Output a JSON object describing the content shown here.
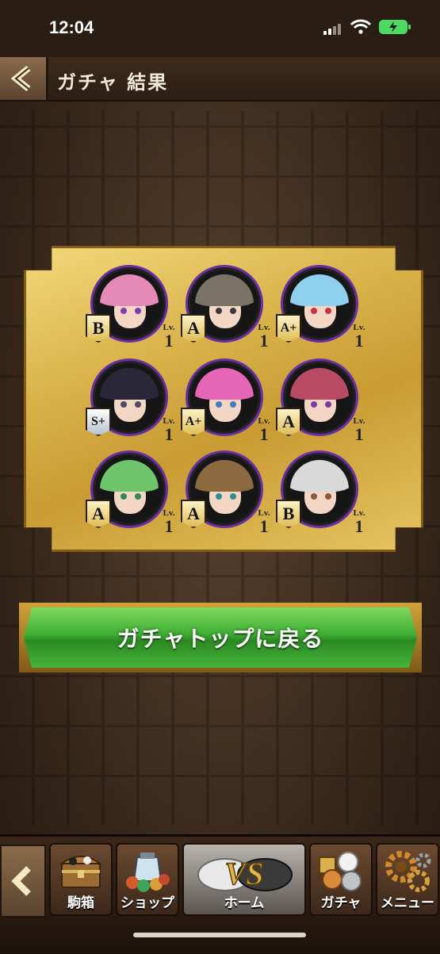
{
  "status_bar": {
    "time": "12:04"
  },
  "header": {
    "title": "ガチャ 結果"
  },
  "results": [
    {
      "rank": "B",
      "level_label": "Lv.",
      "level": "1",
      "hair": "#e589b7",
      "eye": "#7a3fb0",
      "style": "bronze"
    },
    {
      "rank": "A",
      "level_label": "Lv.",
      "level": "1",
      "hair": "#7b7466",
      "eye": "#3a3a3a",
      "style": "gold"
    },
    {
      "rank": "A+",
      "level_label": "Lv.",
      "level": "1",
      "hair": "#8fd0ee",
      "eye": "#c0334b",
      "style": "gold"
    },
    {
      "rank": "S+",
      "level_label": "Lv.",
      "level": "1",
      "hair": "#2a2838",
      "eye": "#4a4a6a",
      "style": "silver"
    },
    {
      "rank": "A+",
      "level_label": "Lv.",
      "level": "1",
      "hair": "#e565b6",
      "eye": "#3f7fc2",
      "style": "gold"
    },
    {
      "rank": "A",
      "level_label": "Lv.",
      "level": "1",
      "hair": "#b84a63",
      "eye": "#7e3aa6",
      "style": "gold"
    },
    {
      "rank": "A",
      "level_label": "Lv.",
      "level": "1",
      "hair": "#6fc46b",
      "eye": "#2f8a54",
      "style": "gold"
    },
    {
      "rank": "A",
      "level_label": "Lv.",
      "level": "1",
      "hair": "#8c6a3f",
      "eye": "#2e8f8b",
      "style": "gold"
    },
    {
      "rank": "B",
      "level_label": "Lv.",
      "level": "1",
      "hair": "#d9d9d9",
      "eye": "#8a5a3a",
      "style": "bronze"
    }
  ],
  "cta": {
    "label": "ガチャトップに戻る"
  },
  "nav": {
    "tabs": [
      {
        "label": "駒箱",
        "icon": "treasure-chest-icon"
      },
      {
        "label": "ショップ",
        "icon": "shop-bag-icon"
      },
      {
        "label": "ホーム",
        "icon": "vs-home-icon"
      },
      {
        "label": "ガチャ",
        "icon": "gacha-coins-icon"
      },
      {
        "label": "メニュー",
        "icon": "gears-icon"
      }
    ]
  }
}
